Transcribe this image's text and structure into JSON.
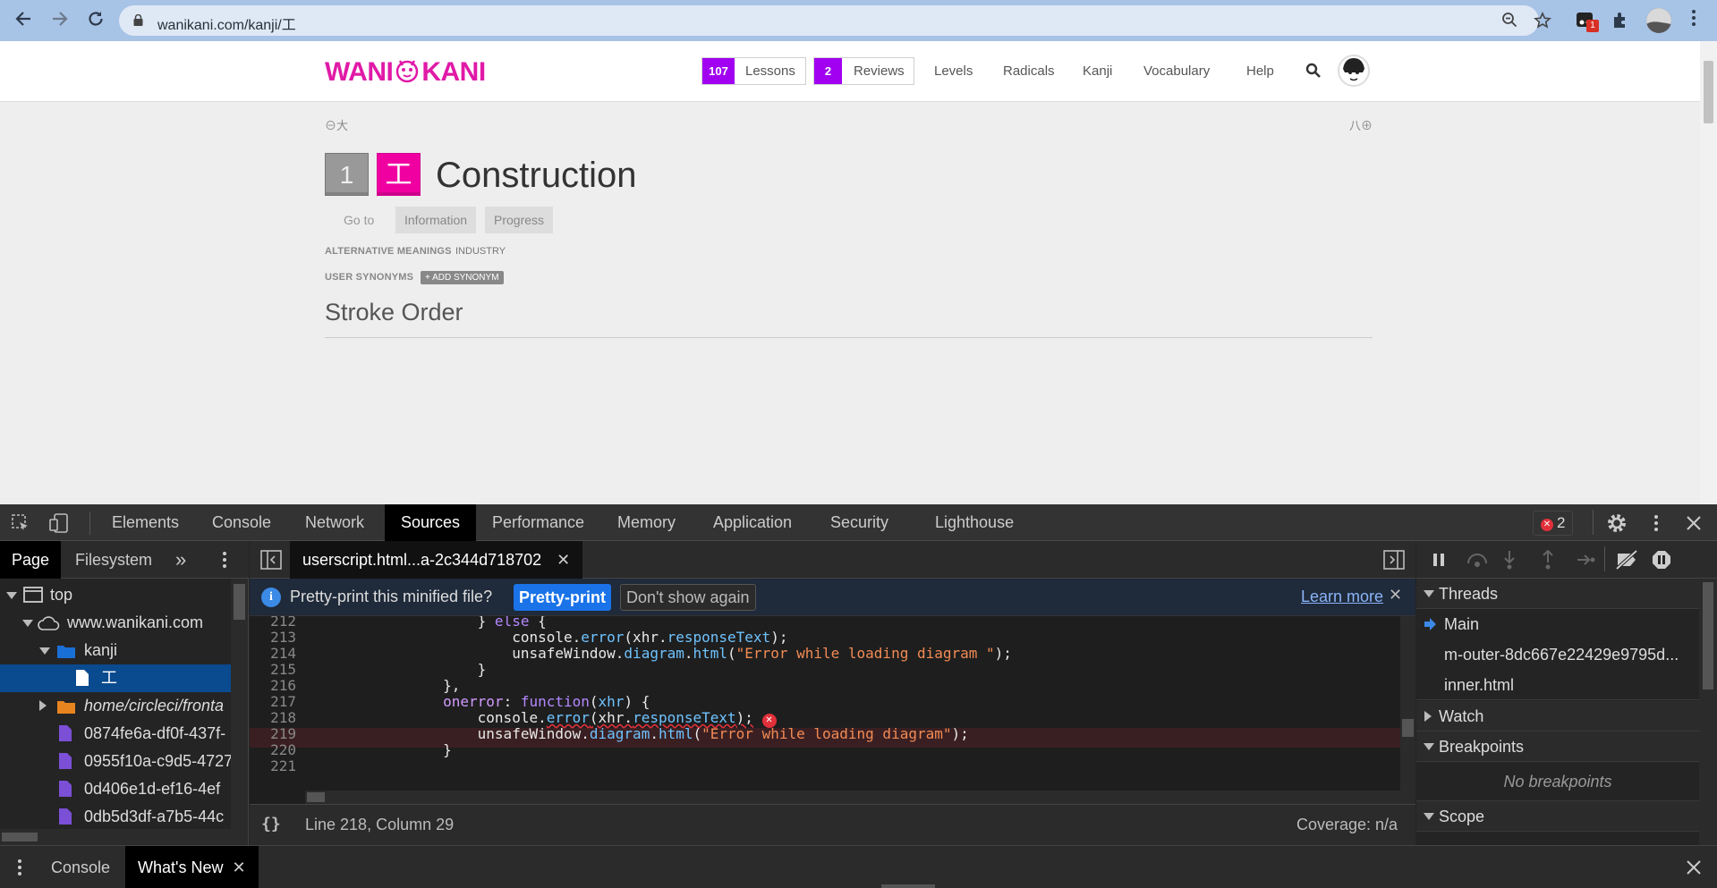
{
  "browser": {
    "url_host": "wanikani.com",
    "url_path": "/kanji/工",
    "extension_badge": "1"
  },
  "site": {
    "logo_left": "WANI",
    "logo_right": "KANI",
    "lessons": {
      "count": "107",
      "label": "Lessons"
    },
    "reviews": {
      "count": "2",
      "label": "Reviews"
    },
    "nav": [
      "Levels",
      "Radicals",
      "Kanji",
      "Vocabulary",
      "Help"
    ],
    "prev_kanji": "大",
    "next_kanji": "八",
    "level": "1",
    "kanji": "工",
    "meaning": "Construction",
    "goto_label": "Go to",
    "tabs": [
      "Information",
      "Progress"
    ],
    "alt_meanings_label": "ALTERNATIVE MEANINGS",
    "alt_meanings_value": "INDUSTRY",
    "user_synonyms_label": "USER SYNONYMS",
    "add_synonym_label": "+ ADD SYNONYM",
    "section_title": "Stroke Order",
    "accent_color": "#f100a1",
    "count_color": "#a100f1"
  },
  "devtools": {
    "tabs": [
      "Elements",
      "Console",
      "Network",
      "Sources",
      "Performance",
      "Memory",
      "Application",
      "Security",
      "Lighthouse"
    ],
    "active_tab": "Sources",
    "error_count": "2",
    "navigator": {
      "tabs": [
        "Page",
        "Filesystem"
      ],
      "tree": [
        {
          "label": "top"
        },
        {
          "label": "www.wanikani.com"
        },
        {
          "label": "kanji"
        },
        {
          "label": "工"
        },
        {
          "label": "home/circleci/fronta"
        },
        {
          "label": "0874fe6a-df0f-437f-"
        },
        {
          "label": "0955f10a-c9d5-4727"
        },
        {
          "label": "0d406e1d-ef16-4ef"
        },
        {
          "label": "0db5d3df-a7b5-44c"
        }
      ]
    },
    "editor": {
      "file_tab": "userscript.html...a-2c344d718702",
      "banner_msg": "Pretty-print this minified file?",
      "pretty_print_btn": "Pretty-print",
      "dont_show_btn": "Don't show again",
      "learn_more": "Learn more",
      "lines": [
        {
          "n": "212",
          "t": "                    } else {"
        },
        {
          "n": "213",
          "t": "                        console.error(xhr.responseText);"
        },
        {
          "n": "214",
          "t": "                        unsafeWindow.diagram.html(\"Error while loading diagram \");"
        },
        {
          "n": "215",
          "t": "                    }"
        },
        {
          "n": "216",
          "t": "                },"
        },
        {
          "n": "217",
          "t": "                onerror: function(xhr) {"
        },
        {
          "n": "218",
          "t": "                    console.error(xhr.responseText);"
        },
        {
          "n": "219",
          "t": "                    unsafeWindow.diagram.html(\"Error while loading diagram\");"
        },
        {
          "n": "220",
          "t": "                }"
        },
        {
          "n": "221",
          "t": ""
        }
      ],
      "status_position": "Line 218, Column 29",
      "coverage": "Coverage: n/a"
    },
    "debugger": {
      "threads_label": "Threads",
      "threads": [
        "Main",
        "m-outer-8dc667e22429e9795d...",
        "inner.html"
      ],
      "watch_label": "Watch",
      "breakpoints_label": "Breakpoints",
      "no_breakpoints": "No breakpoints",
      "scope_label": "Scope"
    },
    "drawer": {
      "tabs": [
        "Console",
        "What's New"
      ]
    }
  }
}
